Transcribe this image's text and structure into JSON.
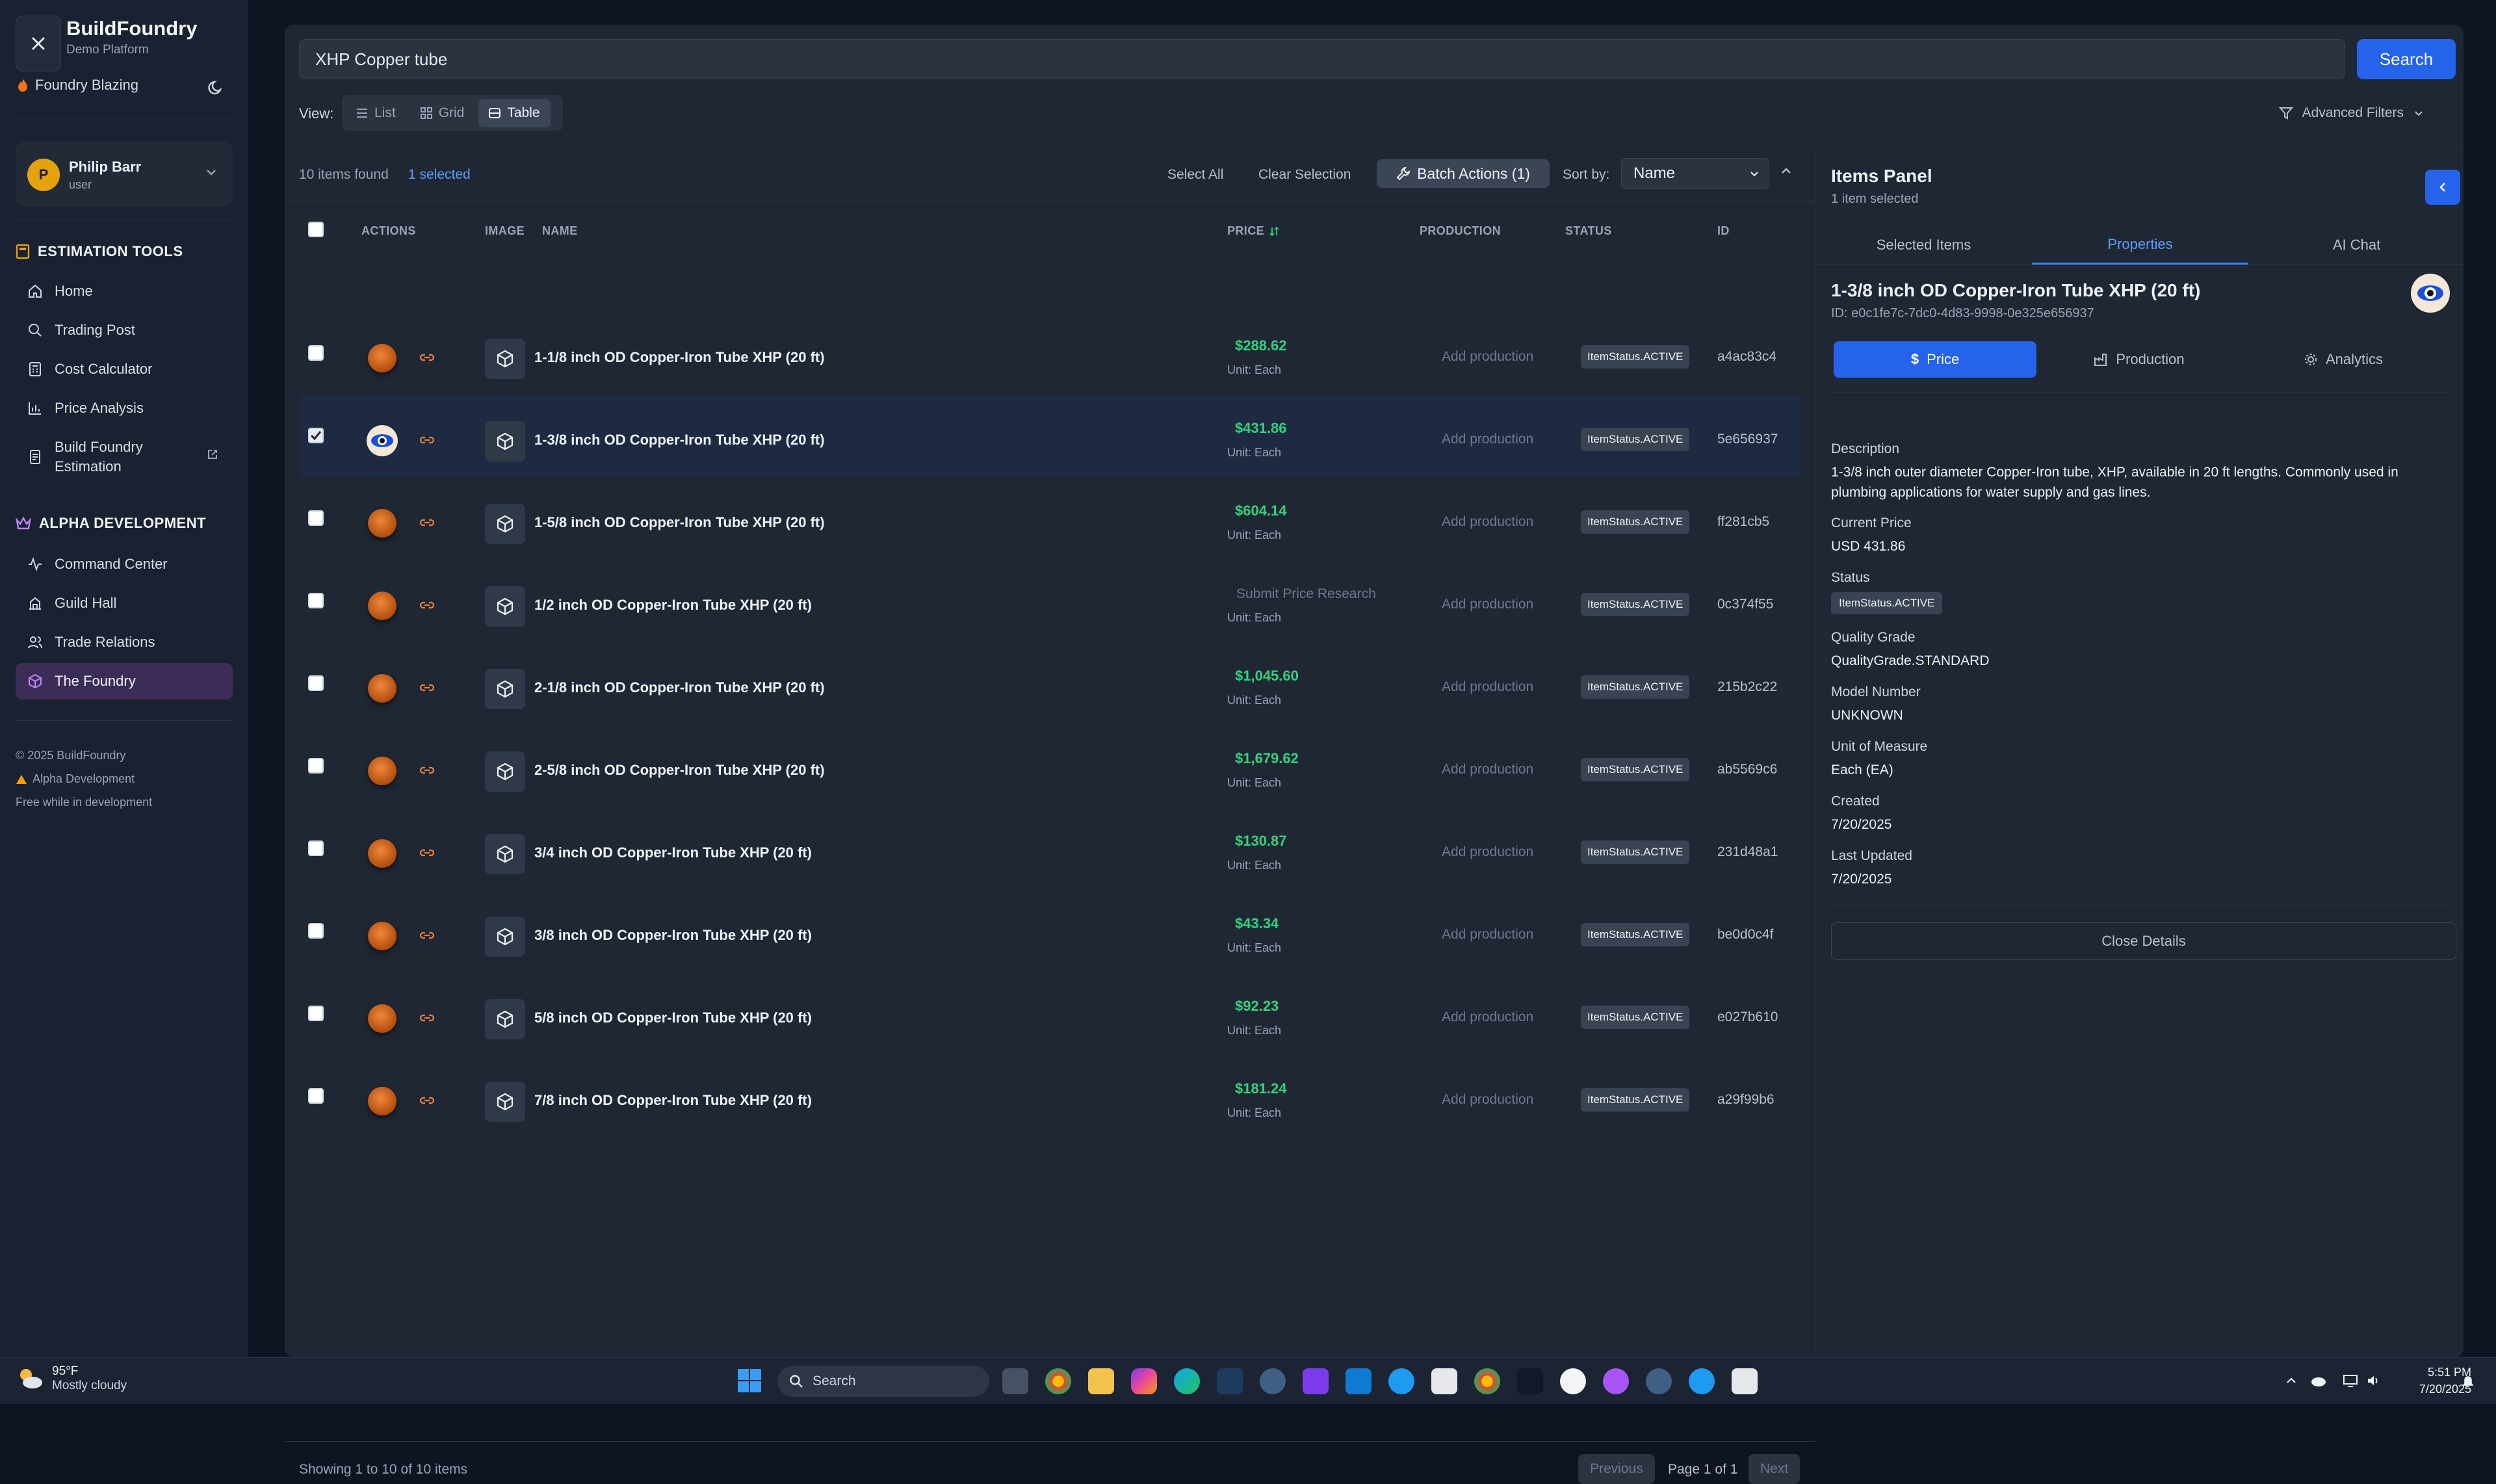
{
  "sidebar": {
    "brand_title": "BuildFoundry",
    "brand_sub": "Demo Platform",
    "status": "Foundry Blazing",
    "user": {
      "initial": "P",
      "name": "Philip Barr",
      "role": "user"
    },
    "estimation_title": "ESTIMATION TOOLS",
    "estimation_items": [
      "Home",
      "Trading Post",
      "Cost Calculator",
      "Price Analysis",
      "Build Foundry",
      "Estimation"
    ],
    "alpha_title": "ALPHA DEVELOPMENT",
    "alpha_items": [
      "Command Center",
      "Guild Hall",
      "Trade Relations",
      "The Foundry"
    ],
    "footer_copyright": "© 2025 BuildFoundry",
    "footer_alpha": "Alpha Development",
    "footer_free": "Free while in development"
  },
  "search": {
    "value": "XHP Copper tube",
    "button": "Search"
  },
  "view": {
    "label": "View:",
    "options": [
      "List",
      "Grid",
      "Table"
    ],
    "active": "Table",
    "advanced_filters": "Advanced Filters"
  },
  "toolbar": {
    "items_found": "10 items found",
    "selected": "1 selected",
    "select_all": "Select All",
    "clear_selection": "Clear Selection",
    "batch_actions": "Batch Actions (1)",
    "sort_label": "Sort by:",
    "sort_value": "Name"
  },
  "table": {
    "headers": {
      "actions": "ACTIONS",
      "image": "IMAGE",
      "name": "NAME",
      "price": "PRICE",
      "production": "PRODUCTION",
      "status": "STATUS",
      "id": "ID"
    },
    "rows": [
      {
        "name": "1-1/8 inch OD Copper-Iron Tube XHP (20 ft)",
        "price": "$288.62",
        "unit": "Unit: Each",
        "production": "Add production",
        "status": "ItemStatus.ACTIVE",
        "id": "a4ac83c4"
      },
      {
        "name": "1-3/8 inch OD Copper-Iron Tube XHP (20 ft)",
        "price": "$431.86",
        "unit": "Unit: Each",
        "production": "Add production",
        "status": "ItemStatus.ACTIVE",
        "id": "5e656937"
      },
      {
        "name": "1-5/8 inch OD Copper-Iron Tube XHP (20 ft)",
        "price": "$604.14",
        "unit": "Unit: Each",
        "production": "Add production",
        "status": "ItemStatus.ACTIVE",
        "id": "ff281cb5"
      },
      {
        "name": "1/2 inch OD Copper-Iron Tube XHP (20 ft)",
        "price": "Submit Price Research",
        "unit": "Unit: Each",
        "production": "Add production",
        "status": "ItemStatus.ACTIVE",
        "id": "0c374f55"
      },
      {
        "name": "2-1/8 inch OD Copper-Iron Tube XHP (20 ft)",
        "price": "$1,045.60",
        "unit": "Unit: Each",
        "production": "Add production",
        "status": "ItemStatus.ACTIVE",
        "id": "215b2c22"
      },
      {
        "name": "2-5/8 inch OD Copper-Iron Tube XHP (20 ft)",
        "price": "$1,679.62",
        "unit": "Unit: Each",
        "production": "Add production",
        "status": "ItemStatus.ACTIVE",
        "id": "ab5569c6"
      },
      {
        "name": "3/4 inch OD Copper-Iron Tube XHP (20 ft)",
        "price": "$130.87",
        "unit": "Unit: Each",
        "production": "Add production",
        "status": "ItemStatus.ACTIVE",
        "id": "231d48a1"
      },
      {
        "name": "3/8 inch OD Copper-Iron Tube XHP (20 ft)",
        "price": "$43.34",
        "unit": "Unit: Each",
        "production": "Add production",
        "status": "ItemStatus.ACTIVE",
        "id": "be0d0c4f"
      },
      {
        "name": "5/8 inch OD Copper-Iron Tube XHP (20 ft)",
        "price": "$92.23",
        "unit": "Unit: Each",
        "production": "Add production",
        "status": "ItemStatus.ACTIVE",
        "id": "e027b610"
      },
      {
        "name": "7/8 inch OD Copper-Iron Tube XHP (20 ft)",
        "price": "$181.24",
        "unit": "Unit: Each",
        "production": "Add production",
        "status": "ItemStatus.ACTIVE",
        "id": "a29f99b6"
      }
    ]
  },
  "pagination": {
    "showing": "Showing 1 to 10 of 10 items",
    "previous": "Previous",
    "page": "Page 1 of 1",
    "next": "Next"
  },
  "panel": {
    "title": "Items Panel",
    "subtitle": "1 item selected",
    "tabs": [
      "Selected Items",
      "Properties",
      "AI Chat"
    ],
    "active_tab": "Properties",
    "item_title": "1-3/8 inch OD Copper-Iron Tube XHP (20 ft)",
    "item_id": "ID: e0c1fe7c-7dc0-4d83-9998-0e325e656937",
    "subtabs": [
      "Price",
      "Production",
      "Analytics"
    ],
    "fields": {
      "description_label": "Description",
      "description": "1-3/8 inch outer diameter Copper-Iron tube, XHP, available in 20 ft lengths. Commonly used in plumbing applications for water supply and gas lines.",
      "current_price_label": "Current Price",
      "current_price": "USD 431.86",
      "status_label": "Status",
      "status": "ItemStatus.ACTIVE",
      "quality_label": "Quality Grade",
      "quality": "QualityGrade.STANDARD",
      "model_label": "Model Number",
      "model": "UNKNOWN",
      "uom_label": "Unit of Measure",
      "uom": "Each (EA)",
      "created_label": "Created",
      "created": "7/20/2025",
      "updated_label": "Last Updated",
      "updated": "7/20/2025"
    },
    "close_details": "Close Details"
  },
  "taskbar": {
    "temp": "95°F",
    "weather": "Mostly cloudy",
    "search": "Search",
    "time": "5:51 PM",
    "date": "7/20/2025"
  },
  "colors": {
    "accent": "#2563eb",
    "price_green": "#34d27a",
    "active_nav": "#3b2d56"
  }
}
